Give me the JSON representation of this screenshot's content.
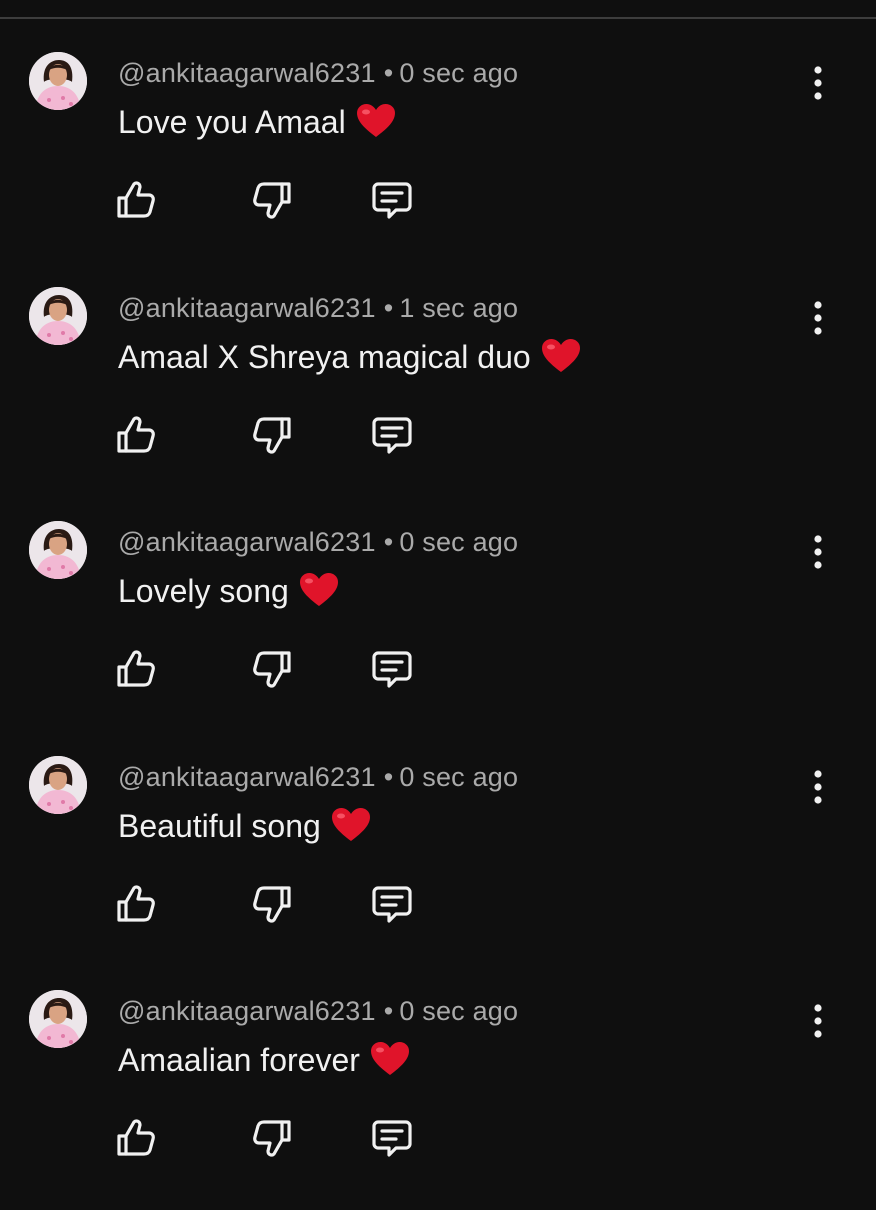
{
  "colors": {
    "background": "#0f0f0f",
    "meta_text": "#aaaaaa",
    "body_text": "#f1f1f1",
    "heart": "#e0142a"
  },
  "icons": {
    "like": "thumbs-up-icon",
    "dislike": "thumbs-down-icon",
    "reply": "comment-bubble-icon",
    "more": "vertical-dots-icon",
    "heart": "red-heart-emoji"
  },
  "comments": [
    {
      "author": "@ankitaagarwal6231",
      "time": "0 sec ago",
      "text": "Love you Amaal"
    },
    {
      "author": "@ankitaagarwal6231",
      "time": "1 sec ago",
      "text": "Amaal X Shreya magical duo"
    },
    {
      "author": "@ankitaagarwal6231",
      "time": "0 sec ago",
      "text": "Lovely song"
    },
    {
      "author": "@ankitaagarwal6231",
      "time": "0 sec ago",
      "text": "Beautiful song"
    },
    {
      "author": "@ankitaagarwal6231",
      "time": "0 sec ago",
      "text": "Amaalian forever"
    }
  ]
}
